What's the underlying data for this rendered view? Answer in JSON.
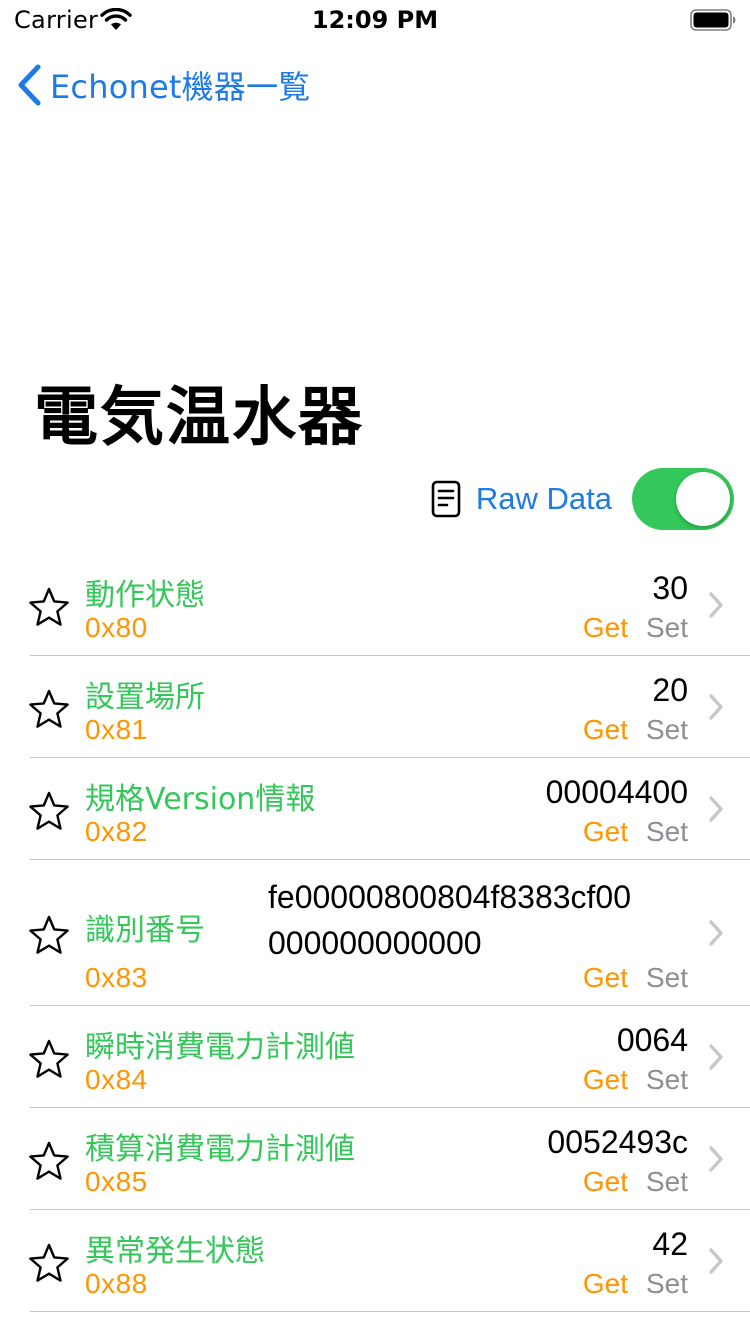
{
  "status_bar": {
    "carrier": "Carrier",
    "time": "12:09 PM"
  },
  "nav": {
    "back_label": "Echonet機器一覧"
  },
  "title": "電気温水器",
  "raw_data": {
    "label": "Raw Data",
    "enabled": true
  },
  "colors": {
    "accent": "#1e7ae6",
    "green": "#34c759",
    "orange": "#ff9500",
    "gray": "#8e8e93"
  },
  "properties": [
    {
      "name": "動作状態",
      "code": "0x80",
      "value": "30",
      "get": "Get",
      "set": "Set"
    },
    {
      "name": "設置場所",
      "code": "0x81",
      "value": "20",
      "get": "Get",
      "set": "Set"
    },
    {
      "name": "規格Version情報",
      "code": "0x82",
      "value": "00004400",
      "get": "Get",
      "set": "Set"
    },
    {
      "name": "識別番号",
      "code": "0x83",
      "value": "fe00000800804f8383cf00000000000000",
      "value_line1": "fe00000800804f8383cf00",
      "value_line2": "000000000000",
      "get": "Get",
      "set": "Set"
    },
    {
      "name": "瞬時消費電力計測値",
      "code": "0x84",
      "value": "0064",
      "get": "Get",
      "set": "Set"
    },
    {
      "name": "積算消費電力計測値",
      "code": "0x85",
      "value": "0052493c",
      "get": "Get",
      "set": "Set"
    },
    {
      "name": "異常発生状態",
      "code": "0x88",
      "value": "42",
      "get": "Get",
      "set": "Set"
    }
  ]
}
